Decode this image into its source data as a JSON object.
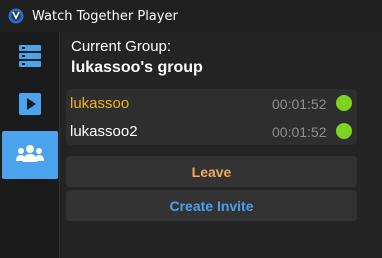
{
  "window": {
    "title": "Watch Together Player"
  },
  "sidebar": {
    "items": [
      {
        "icon": "server-list-icon",
        "active": false
      },
      {
        "icon": "play-icon",
        "active": false
      },
      {
        "icon": "group-icon",
        "active": true
      }
    ]
  },
  "group": {
    "label": "Current Group:",
    "name": "lukassoo's group"
  },
  "members": [
    {
      "name": "lukassoo",
      "time": "00:01:52",
      "status": "online"
    },
    {
      "name": "lukassoo2",
      "time": "00:01:52",
      "status": "online"
    }
  ],
  "actions": {
    "leave_label": "Leave",
    "invite_label": "Create Invite"
  },
  "colors": {
    "accent": "#4aa3ec",
    "self_name": "#f2b51d",
    "status_online": "#7ed321",
    "leave": "#f0a860",
    "invite": "#4a9ff0"
  }
}
